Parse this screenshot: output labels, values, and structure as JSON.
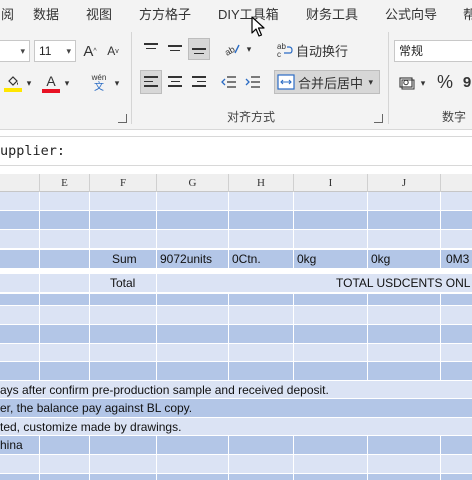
{
  "ribbon_tabs": [
    "审阅",
    "数据",
    "视图",
    "方方格子",
    "DIY工具箱",
    "财务工具",
    "公式向导",
    "帮助"
  ],
  "font": {
    "size": "11",
    "grow_label": "A",
    "shrink_label": "A",
    "font_color_label": "A",
    "phonetic_top": "wén",
    "phonetic_bottom": "文"
  },
  "alignment": {
    "wrap_text": "自动换行",
    "merge_center": "合并后居中",
    "group_label": "对齐方式",
    "orientation_label": "ab"
  },
  "number": {
    "format": "常规",
    "percent": "%",
    "group_label": "数字"
  },
  "formula_bar": {
    "text": "upplier:"
  },
  "columns": [
    "E",
    "F",
    "G",
    "H",
    "I",
    "J"
  ],
  "rows": {
    "sum": {
      "label": "Sum",
      "units": "9072units",
      "ctn": "0Ctn.",
      "kg1": "0kg",
      "kg2": "0kg",
      "m3": "0M3"
    },
    "total": {
      "label": "Total",
      "text": "TOTAL USDCENTS ONL"
    },
    "terms": [
      "ays after confirm pre-production sample and received deposit.",
      "er, the balance pay against BL copy.",
      "ted, customize made by drawings.",
      "hina"
    ]
  },
  "colors": {
    "row_light": "#dbe3f4",
    "row_dark": "#b3c6e7",
    "font_color": "#e81123",
    "fill_color": "#ffe600"
  }
}
